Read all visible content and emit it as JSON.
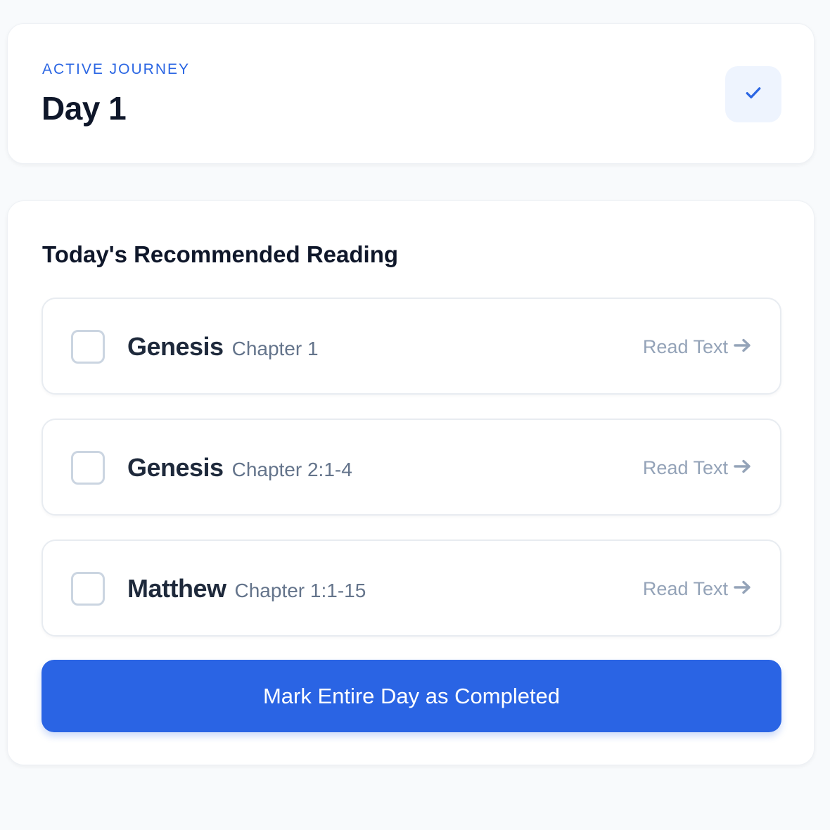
{
  "header": {
    "eyebrow": "ACTIVE JOURNEY",
    "title": "Day 1",
    "status_icon": "check-icon"
  },
  "reading": {
    "section_title": "Today's Recommended Reading",
    "items": [
      {
        "book": "Genesis",
        "chapter": "Chapter 1",
        "link_label": "Read Text",
        "checked": false
      },
      {
        "book": "Genesis",
        "chapter": "Chapter 2:1-4",
        "link_label": "Read Text",
        "checked": false
      },
      {
        "book": "Matthew",
        "chapter": "Chapter 1:1-15",
        "link_label": "Read Text",
        "checked": false
      }
    ],
    "complete_button_label": "Mark Entire Day as Completed"
  },
  "colors": {
    "accent": "#2a64e4",
    "eyebrow": "#2b66e3",
    "muted": "#94a3b8",
    "background": "#f8fafc"
  }
}
